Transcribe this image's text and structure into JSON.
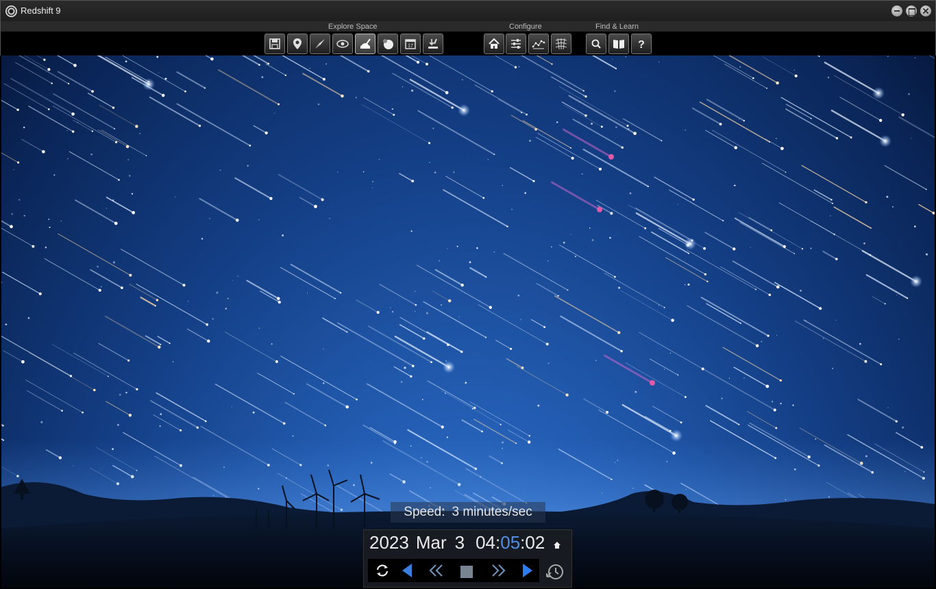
{
  "window": {
    "title": "Redshift 9"
  },
  "toolbar": {
    "groups": {
      "explore": {
        "label": "Explore Space"
      },
      "configure": {
        "label": "Configure"
      },
      "find": {
        "label": "Find & Learn"
      }
    },
    "buttons": [
      {
        "id": "save",
        "icon": "floppy-disk-icon"
      },
      {
        "id": "location",
        "icon": "location-pin-icon"
      },
      {
        "id": "spaceflight",
        "icon": "rocket-icon"
      },
      {
        "id": "view",
        "icon": "eye-orbit-icon"
      },
      {
        "id": "observatory",
        "icon": "observatory-icon",
        "active": true
      },
      {
        "id": "nightsky",
        "icon": "moon-phase-icon"
      },
      {
        "id": "calendar",
        "icon": "calendar-icon",
        "text": "17"
      },
      {
        "id": "download",
        "icon": "download-tool-icon"
      },
      {
        "id": "home",
        "icon": "home-icon"
      },
      {
        "id": "settings",
        "icon": "sliders-icon"
      },
      {
        "id": "constellations",
        "icon": "constellation-icon"
      },
      {
        "id": "grid",
        "icon": "grid-icon"
      },
      {
        "id": "search",
        "icon": "search-icon"
      },
      {
        "id": "book",
        "icon": "book-icon"
      },
      {
        "id": "help",
        "icon": "help-icon"
      }
    ]
  },
  "speed": {
    "label": "Speed:",
    "value": "3 minutes/sec"
  },
  "time": {
    "year": "2023",
    "month": "Mar",
    "day": "3",
    "hour": "04",
    "minute": "05",
    "second": "02",
    "sep1": ":",
    "sep2": ":"
  },
  "colors": {
    "accent": "#4f8fe6",
    "sky_top": "#0a2557",
    "sky_horizon": "#3b7fd6"
  }
}
